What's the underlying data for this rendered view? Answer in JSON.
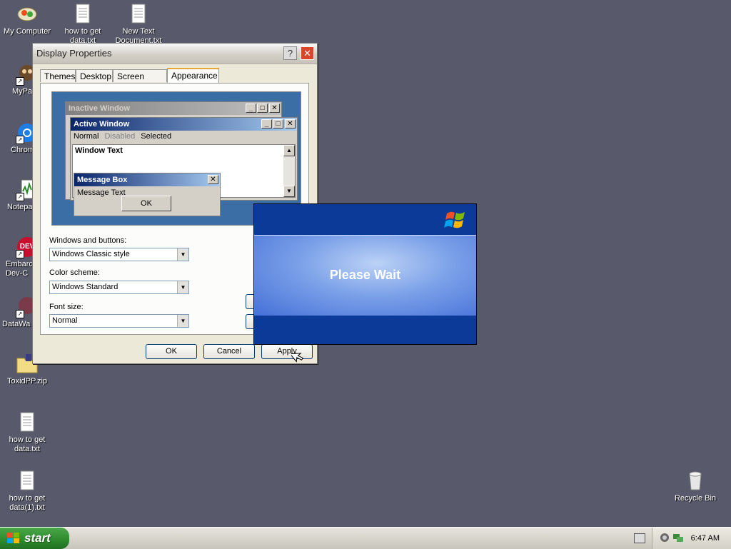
{
  "desktop": {
    "icons": [
      {
        "label": "My Computer"
      },
      {
        "label": "how to get data.txt"
      },
      {
        "label": "New Text Document.txt"
      },
      {
        "label": "MyPa"
      },
      {
        "label": "Chrom"
      },
      {
        "label": "Notepa"
      },
      {
        "label": "Embarca Dev-C"
      },
      {
        "label": "DataWa"
      },
      {
        "label": "ToxidPP.zip"
      },
      {
        "label": "how to get data.txt"
      },
      {
        "label": "how to get data(1).txt"
      },
      {
        "label": "Recycle Bin"
      }
    ]
  },
  "dialog": {
    "title": "Display Properties",
    "help_glyph": "?",
    "close_glyph": "✕",
    "tabs": [
      {
        "label": "Themes"
      },
      {
        "label": "Desktop"
      },
      {
        "label": "Screen Saver"
      },
      {
        "label": "Appearance",
        "active": true
      }
    ],
    "preview": {
      "inactive_title": "Inactive Window",
      "active_title": "Active Window",
      "menu_normal": "Normal",
      "menu_disabled": "Disabled",
      "menu_selected": "Selected",
      "window_text": "Window Text",
      "msgbox_title": "Message Box",
      "msgbox_text": "Message Text",
      "msgbox_ok": "OK"
    },
    "windows_buttons_label": "Windows and buttons:",
    "windows_buttons_value": "Windows Classic style",
    "color_scheme_label": "Color scheme:",
    "color_scheme_value": "Windows Standard",
    "font_size_label": "Font size:",
    "font_size_value": "Normal",
    "ok_label": "OK",
    "cancel_label": "Cancel",
    "apply_label": "Apply"
  },
  "wait_screen": {
    "message": "Please Wait"
  },
  "taskbar": {
    "start_label": "start",
    "clock": "6:47 AM"
  },
  "colors": {
    "desktop": "#58596a",
    "wait_blue": "#0c3a99",
    "start_green": "#2c8a2c"
  }
}
